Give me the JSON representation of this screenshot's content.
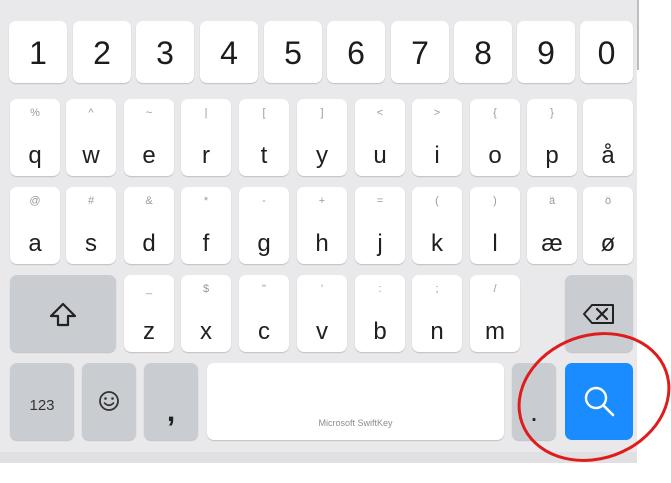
{
  "row_numbers": [
    "1",
    "2",
    "3",
    "4",
    "5",
    "6",
    "7",
    "8",
    "9",
    "0"
  ],
  "row_top": [
    {
      "main": "q",
      "sub": "%"
    },
    {
      "main": "w",
      "sub": "^"
    },
    {
      "main": "e",
      "sub": "~"
    },
    {
      "main": "r",
      "sub": "|"
    },
    {
      "main": "t",
      "sub": "["
    },
    {
      "main": "y",
      "sub": "]"
    },
    {
      "main": "u",
      "sub": "<"
    },
    {
      "main": "i",
      "sub": ">"
    },
    {
      "main": "o",
      "sub": "{"
    },
    {
      "main": "p",
      "sub": "}"
    },
    {
      "main": "å",
      "sub": ""
    }
  ],
  "row_home": [
    {
      "main": "a",
      "sub": "@"
    },
    {
      "main": "s",
      "sub": "#"
    },
    {
      "main": "d",
      "sub": "&"
    },
    {
      "main": "f",
      "sub": "*"
    },
    {
      "main": "g",
      "sub": "-"
    },
    {
      "main": "h",
      "sub": "+"
    },
    {
      "main": "j",
      "sub": "="
    },
    {
      "main": "k",
      "sub": "("
    },
    {
      "main": "l",
      "sub": ")"
    },
    {
      "main": "æ",
      "sub": "ä"
    },
    {
      "main": "ø",
      "sub": "ö"
    }
  ],
  "row_bottom": [
    {
      "main": "z",
      "sub": "_"
    },
    {
      "main": "x",
      "sub": "$"
    },
    {
      "main": "c",
      "sub": "\""
    },
    {
      "main": "v",
      "sub": "'"
    },
    {
      "main": "b",
      "sub": ":"
    },
    {
      "main": "n",
      "sub": ";"
    },
    {
      "main": "m",
      "sub": "/"
    }
  ],
  "keys": {
    "symbols_label": "123",
    "comma_label": ",",
    "space_label": "Microsoft SwiftKey",
    "period_label": "."
  },
  "icons": {
    "shift": "shift-arrow-icon",
    "backspace": "backspace-icon",
    "emoji": "emoji-smiley-icon",
    "search": "search-magnifier-icon"
  },
  "colors": {
    "keyboard_bg": "#e9e9eb",
    "key_bg": "#ffffff",
    "function_key_bg": "#c9ccd1",
    "search_key_bg": "#1a8cff",
    "annotation_circle": "#e01b1b"
  }
}
